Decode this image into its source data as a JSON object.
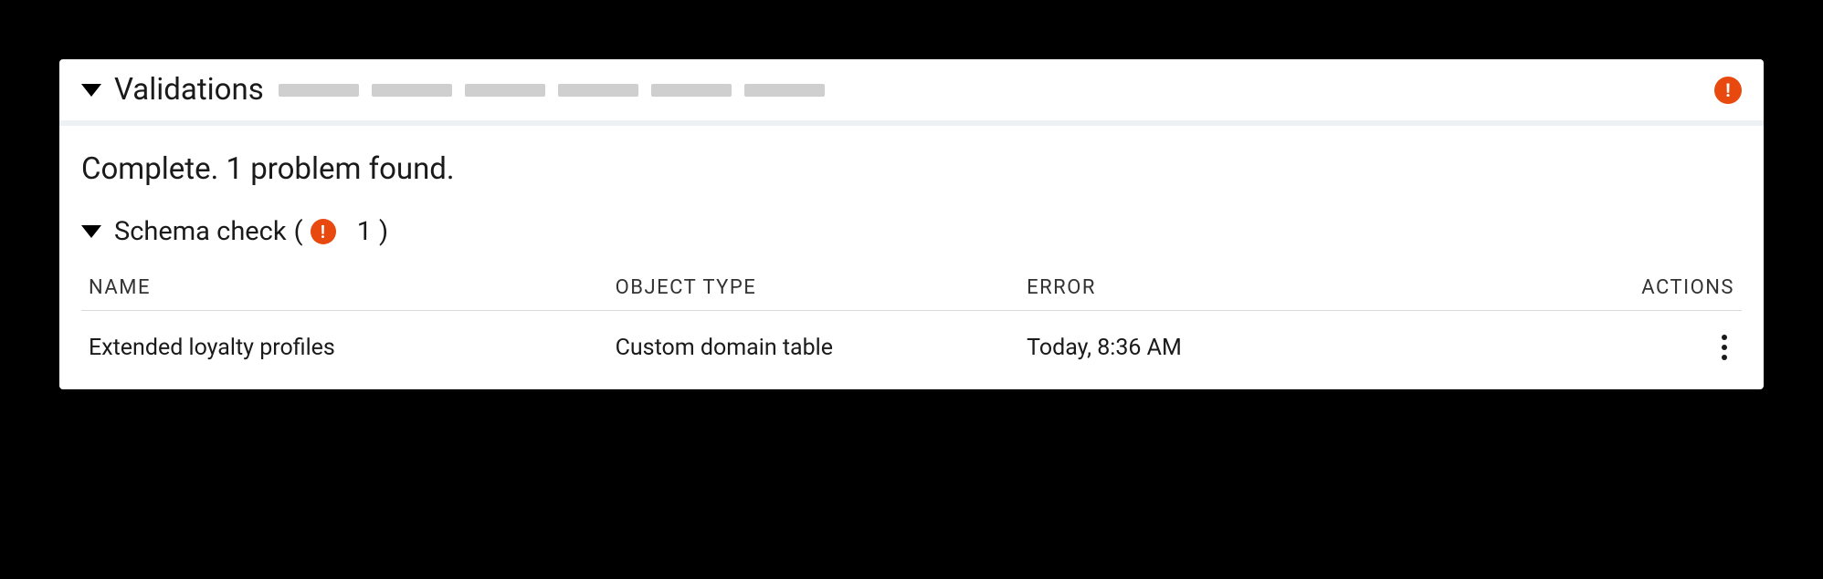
{
  "header": {
    "title": "Validations"
  },
  "status": "Complete. 1 problem found.",
  "subsection": {
    "label": "Schema check",
    "count": "1"
  },
  "table": {
    "columns": {
      "name": "NAME",
      "object_type": "OBJECT TYPE",
      "error": "ERROR",
      "actions": "ACTIONS"
    },
    "rows": [
      {
        "name": "Extended loyalty profiles",
        "object_type": "Custom domain table",
        "error": "Today, 8:36 AM"
      }
    ]
  }
}
